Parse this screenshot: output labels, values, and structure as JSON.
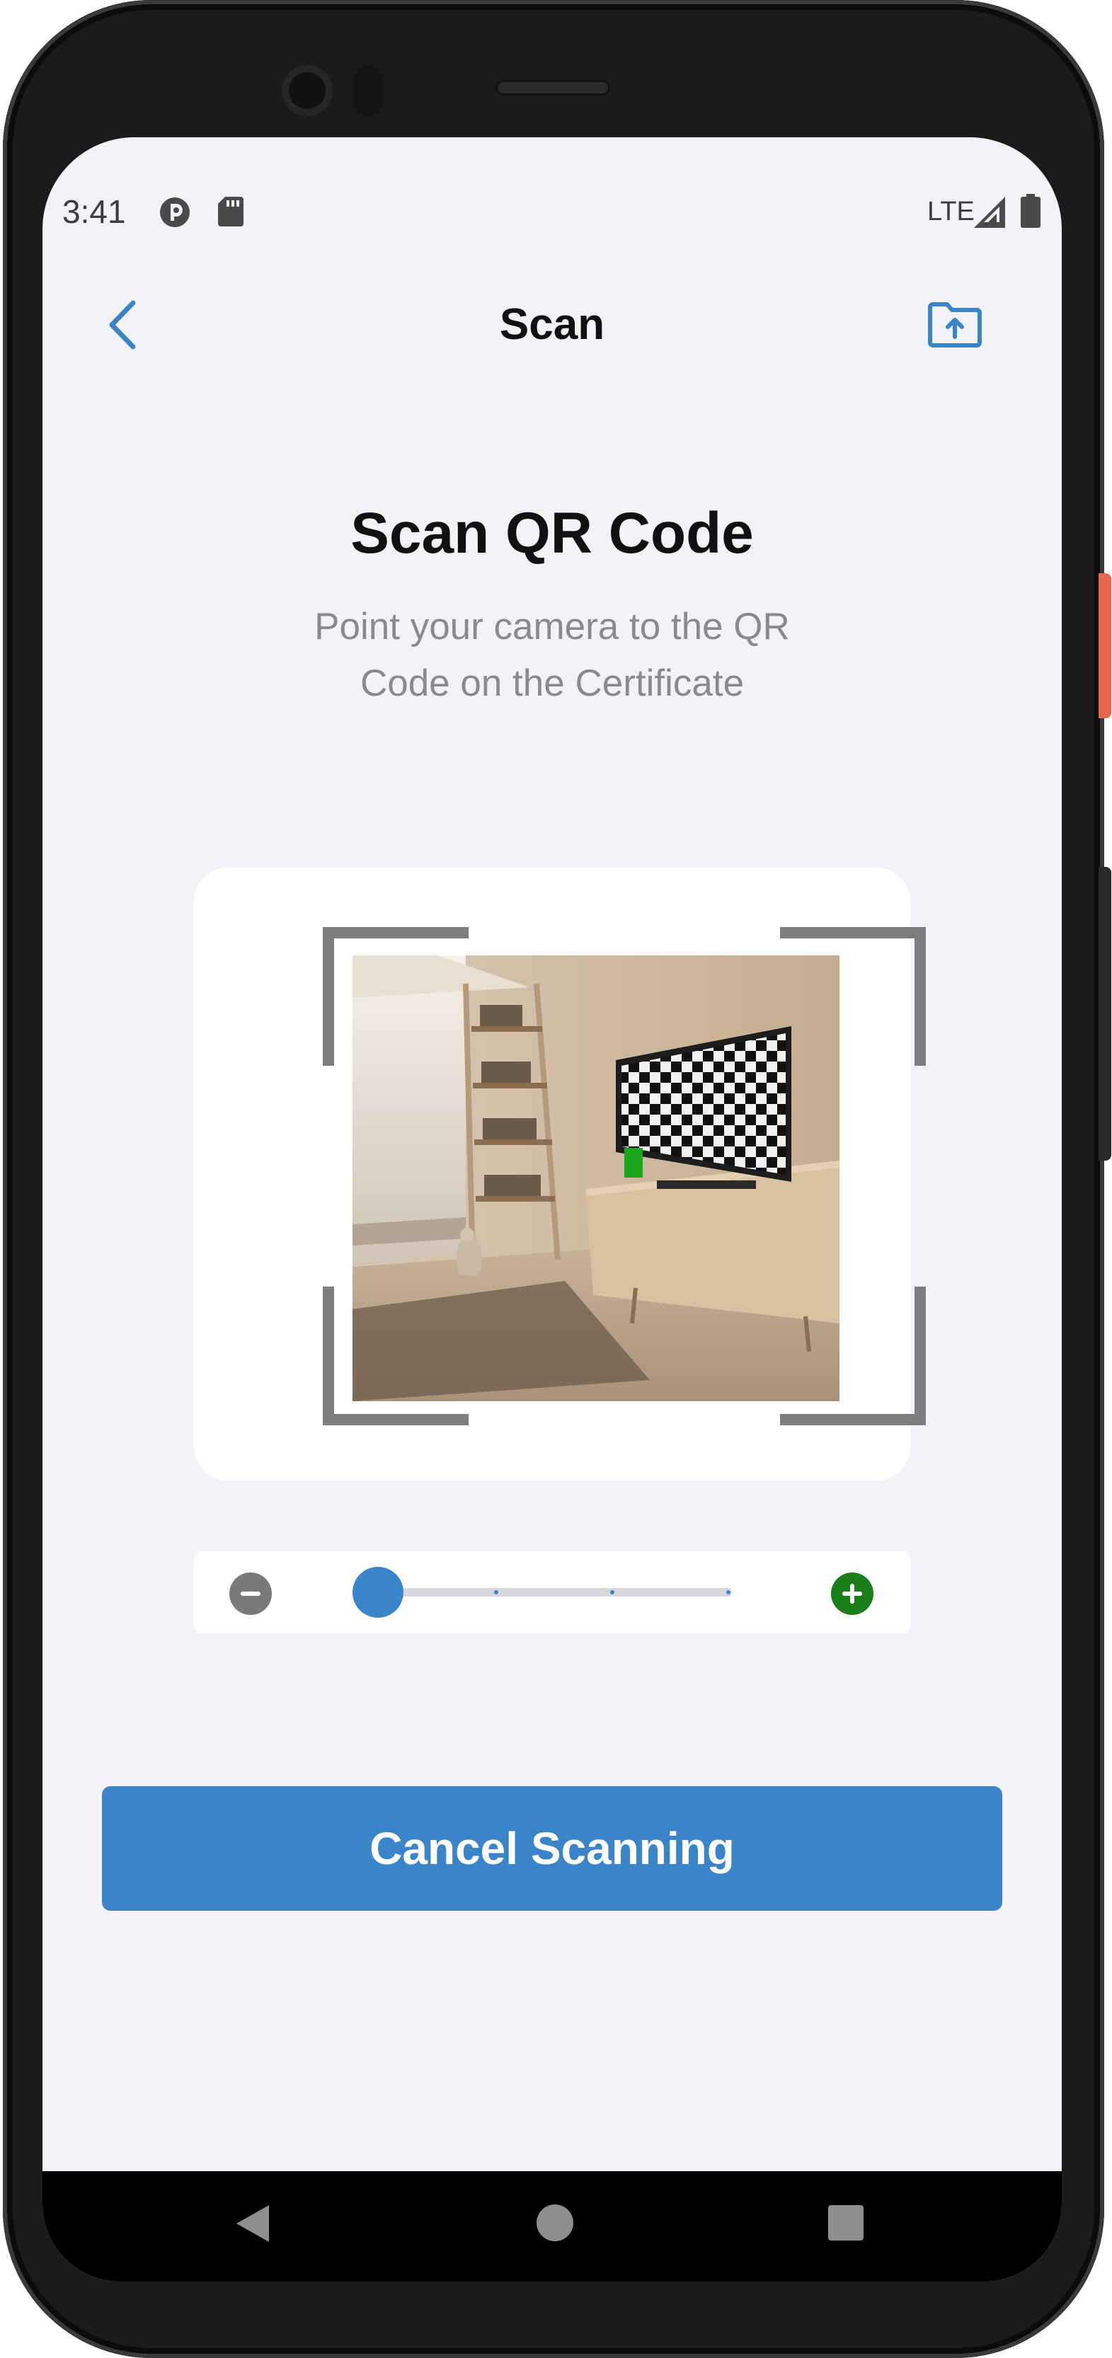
{
  "status_bar": {
    "time": "3:41",
    "network": "LTE",
    "icons": [
      "app-notification-icon",
      "sd-card-icon",
      "signal-icon",
      "battery-icon"
    ]
  },
  "header": {
    "title": "Scan",
    "back_icon": "chevron-left-icon",
    "upload_icon": "folder-upload-icon",
    "accent_color": "#3a84c9"
  },
  "main": {
    "heading": "Scan QR Code",
    "subtitle": "Point your camera to the QR Code on the Certificate"
  },
  "scanner": {
    "frame_color": "#7e7e80",
    "preview_icon": "camera-preview-image"
  },
  "zoom": {
    "level_fraction": 0.0,
    "steps": 4,
    "zoom_out_icon": "minus-circle-icon",
    "zoom_in_icon": "plus-circle-icon",
    "zoom_in_color": "#1a7f1a"
  },
  "actions": {
    "cancel_label": "Cancel Scanning"
  },
  "navigation": {
    "icons": [
      "nav-back-icon",
      "nav-home-icon",
      "nav-recents-icon"
    ]
  }
}
